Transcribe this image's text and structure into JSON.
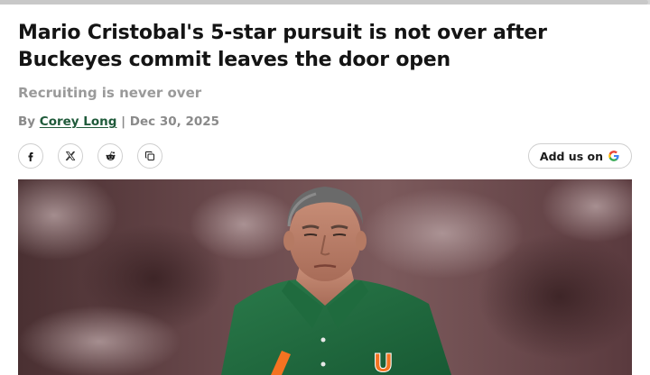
{
  "article": {
    "headline": "Mario Cristobal's 5-star pursuit is not over after Buckeyes commit leaves the door open",
    "subtitle": "Recruiting is never over",
    "byline": {
      "prefix": "By",
      "author": "Corey Long",
      "separator": "|",
      "date": "Dec 30, 2025"
    }
  },
  "share": {
    "icons": [
      "facebook-icon",
      "x-icon",
      "reddit-icon",
      "copy-link-icon"
    ]
  },
  "add_us": {
    "label": "Add us on",
    "icon": "google-icon"
  },
  "hero_image": {
    "jersey_logo": "U"
  },
  "colors": {
    "author_link": "#1f5a3a",
    "subtitle": "#9a9a9a",
    "jersey_green": "#1e6b3f",
    "logo_orange": "#f47321"
  }
}
